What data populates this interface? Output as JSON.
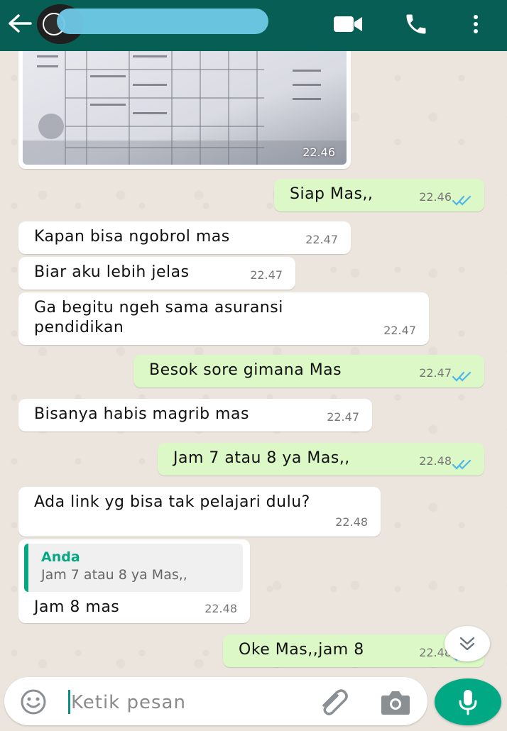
{
  "header": {
    "contact_name": "",
    "icons": [
      "back-arrow-icon",
      "video-call-icon",
      "phone-icon",
      "more-vert-icon"
    ],
    "bg_color": "#075e54"
  },
  "messages": [
    {
      "type": "image",
      "direction": "in",
      "time": "22.46"
    },
    {
      "type": "text",
      "direction": "out",
      "text": "Siap Mas,,",
      "time": "22.46",
      "status": "read"
    },
    {
      "type": "text",
      "direction": "in",
      "text": "Kapan bisa ngobrol mas",
      "time": "22.47"
    },
    {
      "type": "text",
      "direction": "in",
      "text": "Biar aku lebih jelas",
      "time": "22.47"
    },
    {
      "type": "text",
      "direction": "in",
      "text": "Ga begitu ngeh sama asuransi\npendidikan",
      "time": "22.47"
    },
    {
      "type": "text",
      "direction": "out",
      "text": "Besok sore gimana Mas",
      "time": "22.47",
      "status": "read"
    },
    {
      "type": "text",
      "direction": "in",
      "text": "Bisanya habis magrib mas",
      "time": "22.47"
    },
    {
      "type": "text",
      "direction": "out",
      "text": "Jam 7 atau 8 ya Mas,,",
      "time": "22.48",
      "status": "read"
    },
    {
      "type": "text",
      "direction": "in",
      "text": "Ada link yg bisa tak pelajari dulu?",
      "time": "22.48"
    },
    {
      "type": "reply",
      "direction": "in",
      "quote_author": "Anda",
      "quote_text": "Jam 7 atau 8 ya Mas,,",
      "text": "Jam 8 mas",
      "time": "22.48"
    },
    {
      "type": "text",
      "direction": "out",
      "text": "Oke Mas,,jam 8",
      "time": "22.48",
      "status": "read"
    }
  ],
  "composer": {
    "placeholder": "Ketik pesan",
    "icons": [
      "emoji-icon",
      "attach-icon",
      "camera-icon",
      "mic-icon"
    ]
  },
  "colors": {
    "outgoing_bubble": "#dcf8c6",
    "incoming_bubble": "#ffffff",
    "read_ticks": "#4fb6ec",
    "accent": "#00a884"
  }
}
